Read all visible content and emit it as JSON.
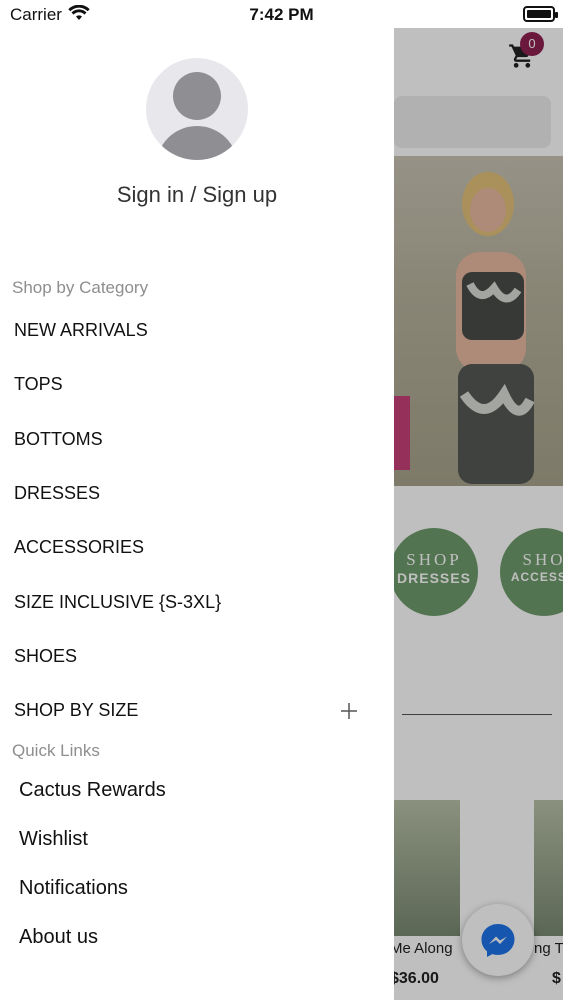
{
  "status_bar": {
    "carrier": "Carrier",
    "time": "7:42 PM"
  },
  "drawer": {
    "sign_in_label": "Sign in / Sign up",
    "shop_section_label": "Shop by Category",
    "categories": [
      {
        "label": "NEW ARRIVALS"
      },
      {
        "label": "TOPS"
      },
      {
        "label": "BOTTOMS"
      },
      {
        "label": "DRESSES"
      },
      {
        "label": "ACCESSORIES"
      },
      {
        "label": "SIZE INCLUSIVE {S-3XL}"
      },
      {
        "label": "SHOES"
      },
      {
        "label": "SHOP BY SIZE"
      }
    ],
    "quick_links_label": "Quick Links",
    "quick_links": [
      {
        "label": "Cactus Rewards"
      },
      {
        "label": "Wishlist"
      },
      {
        "label": "Notifications"
      },
      {
        "label": "About us"
      }
    ]
  },
  "background": {
    "cart_count": "0",
    "circles": [
      {
        "line1": "SHOP",
        "line2": "DRESSES"
      },
      {
        "line1": "SHO",
        "line2": "ACCESSO"
      }
    ],
    "products": [
      {
        "title": "Me Along",
        "price": "$36.00"
      },
      {
        "title": "ng T",
        "price": "$"
      }
    ]
  },
  "icons": {
    "cart": "cart-icon",
    "plus": "plus-icon",
    "messenger": "messenger-icon",
    "avatar": "user-avatar-icon",
    "wifi": "wifi-icon",
    "battery": "battery-icon"
  },
  "colors": {
    "badge": "#8e2252",
    "circle_green": "#6e9b6d",
    "messenger_blue": "#1e73e8"
  }
}
